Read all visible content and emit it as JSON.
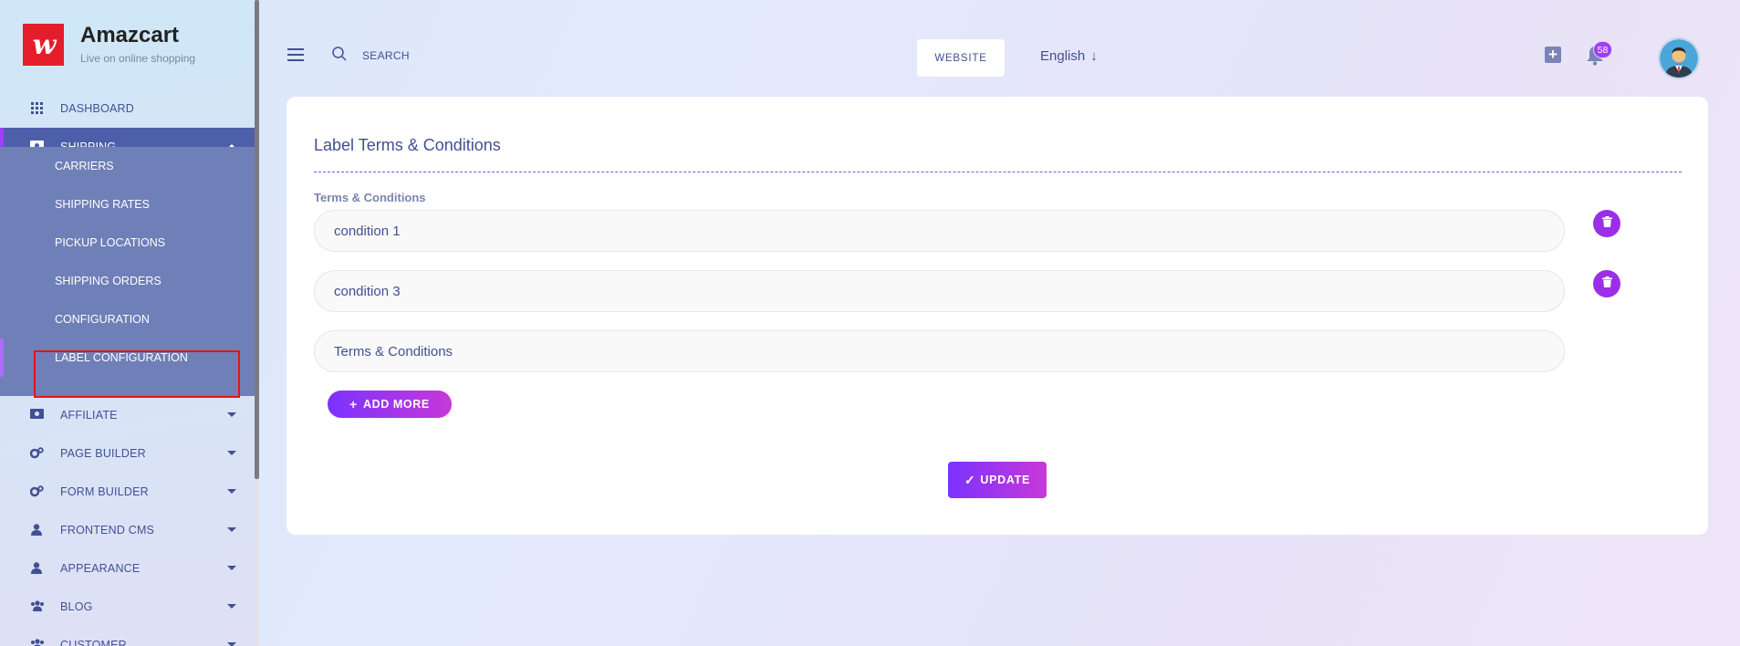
{
  "brand": {
    "name": "Amazcart",
    "tagline": "Live on online shopping",
    "logo_text": "w"
  },
  "sidebar": {
    "items": [
      {
        "label": "DASHBOARD",
        "icon": "grid-icon"
      },
      {
        "label": "SHIPPING",
        "icon": "money-icon"
      },
      {
        "label": "AFFILIATE",
        "icon": "money-icon"
      },
      {
        "label": "PAGE BUILDER",
        "icon": "gears-icon"
      },
      {
        "label": "FORM BUILDER",
        "icon": "gears-icon"
      },
      {
        "label": "FRONTEND CMS",
        "icon": "user-icon"
      },
      {
        "label": "APPEARANCE",
        "icon": "user-icon"
      },
      {
        "label": "BLOG",
        "icon": "users-icon"
      },
      {
        "label": "CUSTOMER",
        "icon": "users-icon"
      }
    ],
    "shipping_submenu": [
      "CARRIERS",
      "SHIPPING RATES",
      "PICKUP LOCATIONS",
      "SHIPPING ORDERS",
      "CONFIGURATION",
      "LABEL CONFIGURATION"
    ]
  },
  "header": {
    "search_label": "SEARCH",
    "website_button": "WEBSITE",
    "language": "English",
    "notification_count": "58"
  },
  "card": {
    "title": "Label Terms & Conditions",
    "field_label": "Terms & Conditions",
    "conditions": [
      "condition 1",
      "condition 3"
    ],
    "new_placeholder": "Terms & Conditions",
    "add_more_label": "ADD MORE",
    "update_label": "UPDATE"
  },
  "colors": {
    "accent": "#9b2fe8",
    "nav_active": "#4d5fa8",
    "submenu_bg": "#6f7fb7",
    "text": "#415094"
  }
}
